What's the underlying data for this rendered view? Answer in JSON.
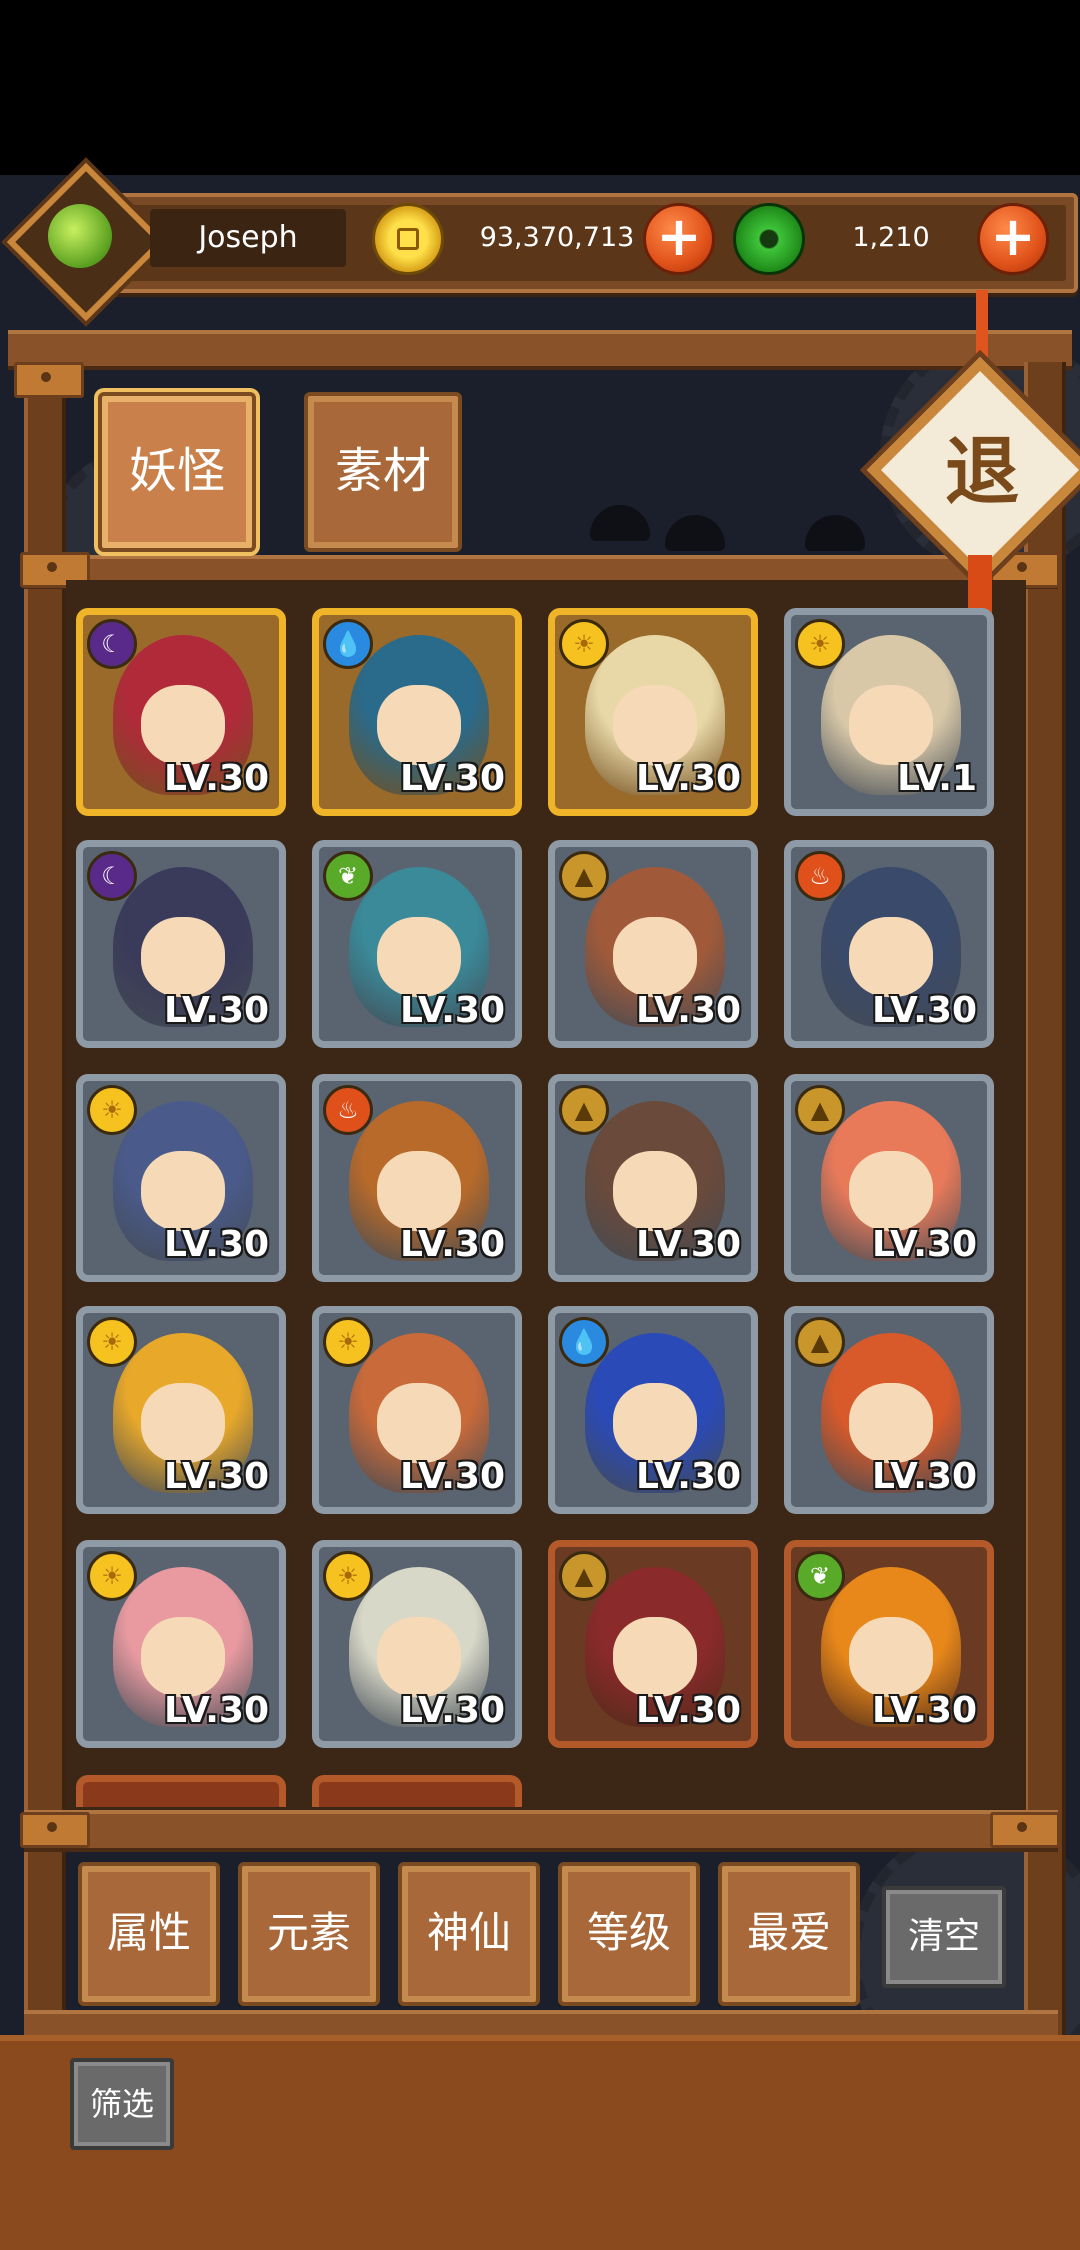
{
  "player": {
    "name": "Joseph",
    "avatar_icon": "green-jade-emblem-icon"
  },
  "currency": {
    "coins": "93,370,713",
    "coins_icon": "gold-coin-icon",
    "jade": "1,210",
    "jade_icon": "jade-disc-icon"
  },
  "tabs": [
    {
      "label": "妖怪",
      "selected": true
    },
    {
      "label": "素材",
      "selected": false
    }
  ],
  "exit_label": "退",
  "heroes": [
    {
      "element": "dark",
      "glyph": "☾",
      "level": "LV.30",
      "frame": "gold",
      "color": "#b02a3a"
    },
    {
      "element": "water",
      "glyph": "💧",
      "level": "LV.30",
      "frame": "gold",
      "color": "#2a6a8a"
    },
    {
      "element": "sun",
      "glyph": "☀",
      "level": "LV.30",
      "frame": "gold",
      "color": "#e8d8a8"
    },
    {
      "element": "sun",
      "glyph": "☀",
      "level": "LV.1",
      "frame": "silver",
      "color": "#d8c8a8"
    },
    {
      "element": "dark",
      "glyph": "☾",
      "level": "LV.30",
      "frame": "silver",
      "color": "#3a3a5a"
    },
    {
      "element": "leaf",
      "glyph": "❦",
      "level": "LV.30",
      "frame": "silver",
      "color": "#3a8a9a"
    },
    {
      "element": "earth",
      "glyph": "▲",
      "level": "LV.30",
      "frame": "silver",
      "color": "#a05a3a"
    },
    {
      "element": "fire",
      "glyph": "♨",
      "level": "LV.30",
      "frame": "silver",
      "color": "#3a4a6a"
    },
    {
      "element": "sun",
      "glyph": "☀",
      "level": "LV.30",
      "frame": "silver",
      "color": "#4a5a8a"
    },
    {
      "element": "fire",
      "glyph": "♨",
      "level": "LV.30",
      "frame": "silver",
      "color": "#b86a2a"
    },
    {
      "element": "earth",
      "glyph": "▲",
      "level": "LV.30",
      "frame": "silver",
      "color": "#6a4a3a"
    },
    {
      "element": "earth",
      "glyph": "▲",
      "level": "LV.30",
      "frame": "silver",
      "color": "#e87a5a"
    },
    {
      "element": "sun",
      "glyph": "☀",
      "level": "LV.30",
      "frame": "silver",
      "color": "#e8a82a"
    },
    {
      "element": "sun",
      "glyph": "☀",
      "level": "LV.30",
      "frame": "silver",
      "color": "#c86a3a"
    },
    {
      "element": "water",
      "glyph": "💧",
      "level": "LV.30",
      "frame": "silver",
      "color": "#2a4ab8"
    },
    {
      "element": "earth",
      "glyph": "▲",
      "level": "LV.30",
      "frame": "silver",
      "color": "#d85a2a"
    },
    {
      "element": "sun",
      "glyph": "☀",
      "level": "LV.30",
      "frame": "silver",
      "color": "#e89aa0"
    },
    {
      "element": "sun",
      "glyph": "☀",
      "level": "LV.30",
      "frame": "silver",
      "color": "#d8d8c8"
    },
    {
      "element": "earth",
      "glyph": "▲",
      "level": "LV.30",
      "frame": "copper",
      "color": "#8a2a2a"
    },
    {
      "element": "leaf",
      "glyph": "❦",
      "level": "LV.30",
      "frame": "copper",
      "color": "#e8881a"
    }
  ],
  "filters": [
    "属性",
    "元素",
    "神仙",
    "等级",
    "最爱"
  ],
  "clear_label": "清空",
  "filter_label": "筛选"
}
